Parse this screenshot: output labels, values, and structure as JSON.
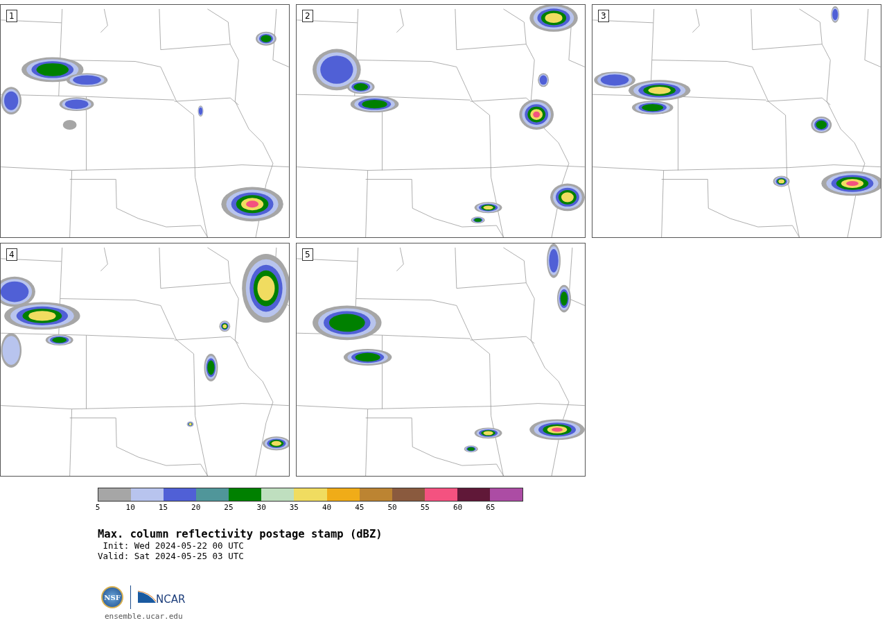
{
  "panels": [
    {
      "label": "1"
    },
    {
      "label": "2"
    },
    {
      "label": "3"
    },
    {
      "label": "4"
    },
    {
      "label": "5"
    }
  ],
  "colorbar": {
    "segments": [
      {
        "color": "#a6a6a6"
      },
      {
        "color": "#b8c4ee"
      },
      {
        "color": "#5060d6"
      },
      {
        "color": "#50969a"
      },
      {
        "color": "#008000"
      },
      {
        "color": "#bfdfbf"
      },
      {
        "color": "#f0dc60"
      },
      {
        "color": "#f0ac18"
      },
      {
        "color": "#bc8432"
      },
      {
        "color": "#8a5a3e"
      },
      {
        "color": "#f45280"
      },
      {
        "color": "#601838"
      },
      {
        "color": "#ac4ca4"
      }
    ],
    "tick_labels": [
      "5",
      "10",
      "15",
      "20",
      "25",
      "30",
      "35",
      "40",
      "45",
      "50",
      "55",
      "60",
      "65"
    ]
  },
  "title": "Max. column reflectivity postage stamp (dBZ)",
  "init": " Init: Wed 2024-05-22 00 UTC",
  "valid": "Valid: Sat 2024-05-25 03 UTC",
  "logos": {
    "nsf": "NSF",
    "ncar": "NCAR"
  },
  "url": "ensemble.ucar.edu"
}
